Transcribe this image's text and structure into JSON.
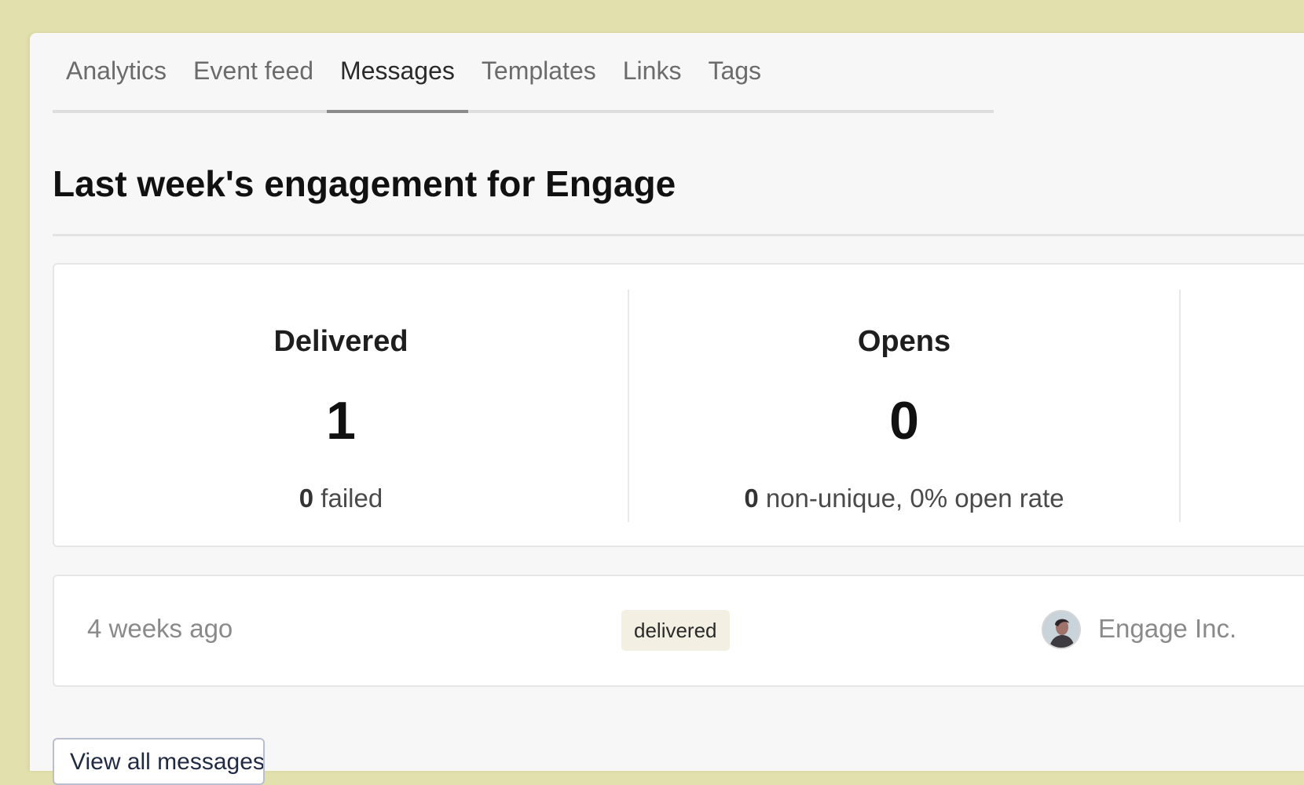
{
  "tabs": [
    {
      "label": "Analytics"
    },
    {
      "label": "Event feed"
    },
    {
      "label": "Messages"
    },
    {
      "label": "Templates"
    },
    {
      "label": "Links"
    },
    {
      "label": "Tags"
    }
  ],
  "active_tab": "Messages",
  "page_title": "Last week's engagement for Engage",
  "stats": {
    "delivered": {
      "label": "Delivered",
      "value": "1",
      "sub_count": "0",
      "sub_text": " failed"
    },
    "opens": {
      "label": "Opens",
      "value": "0",
      "sub_count": "0",
      "sub_text": " non-unique, 0% open rate"
    }
  },
  "messages": [
    {
      "time": "4 weeks ago",
      "status": "delivered",
      "sender": "Engage Inc."
    }
  ],
  "view_all_button": "View all messages",
  "colors": {
    "background": "#e2e0ac",
    "panel": "#f7f7f7",
    "badge": "#f3efe3"
  },
  "icons": {
    "avatar": "user-avatar-photo"
  }
}
